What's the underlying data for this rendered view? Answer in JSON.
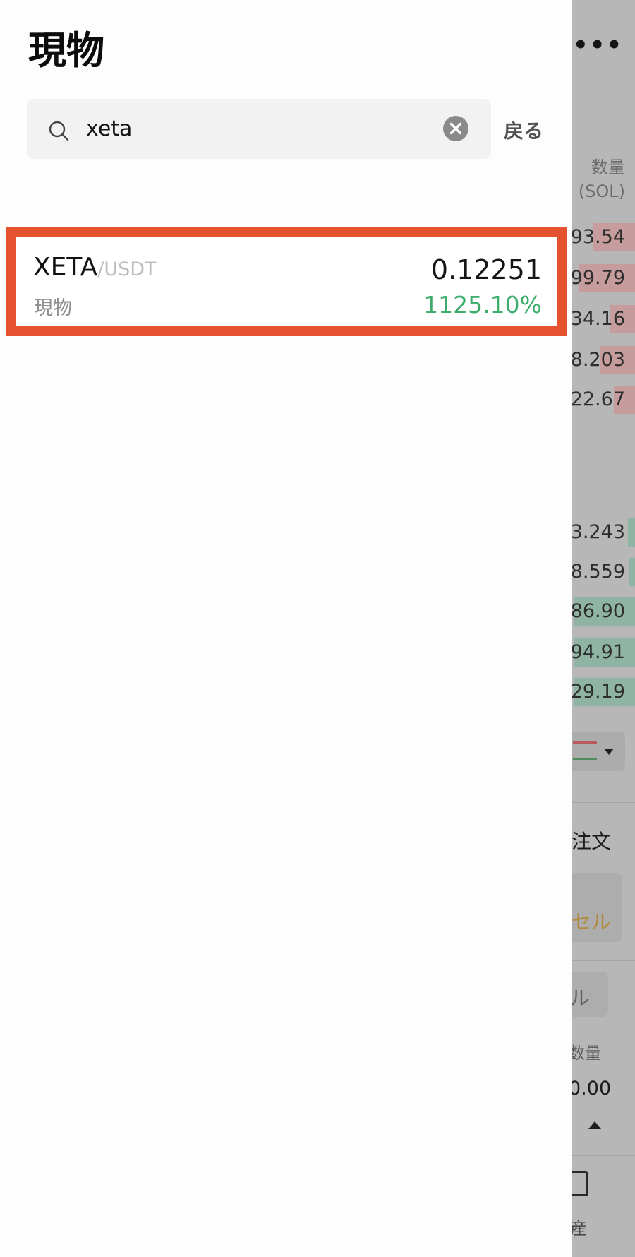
{
  "background": {
    "quantity_header_line1": "数量",
    "quantity_header_line2": "(SOL)",
    "asks": [
      "93.54",
      "99.79",
      "34.16",
      "8.203",
      "22.67"
    ],
    "bids": [
      "3.243",
      "8.559",
      "86.90",
      "94.91",
      "29.19"
    ],
    "order_tab_label": "注文",
    "cancel_label": "セル",
    "chip_label": "ル",
    "available_label": "数量",
    "amount_value": "0.00",
    "assets_label": "産"
  },
  "drawer": {
    "title": "現物",
    "search": {
      "value": "xeta",
      "placeholder": ""
    },
    "back_label": "戻る",
    "results": [
      {
        "base": "XETA",
        "quote": "/USDT",
        "market": "現物",
        "price": "0.12251",
        "change": "1125.10%"
      }
    ]
  },
  "colors": {
    "highlight_border": "#e55230",
    "change_positive": "#3cad6a",
    "ask_bar": "#c69c9c",
    "bid_bar": "#8fb4a4"
  },
  "icons": {
    "search": "search-icon",
    "clear": "clear-icon",
    "more": "more-icon",
    "indicator": "indicator-icon",
    "wallet": "wallet-icon"
  }
}
